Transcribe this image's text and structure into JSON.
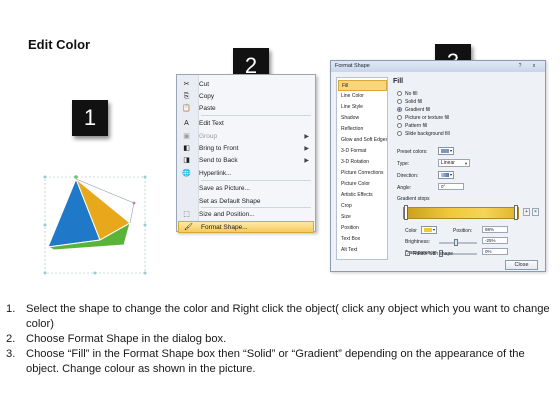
{
  "slide_title": "Edit Color",
  "badges": [
    "1",
    "2",
    "3"
  ],
  "context_menu": {
    "items": [
      {
        "label": "Cut",
        "icon": "scissors-icon",
        "glyph": "✂",
        "submenu": false,
        "disabled": false
      },
      {
        "label": "Copy",
        "icon": "copy-icon",
        "glyph": "⎘",
        "submenu": false,
        "disabled": false
      },
      {
        "label": "Paste",
        "icon": "paste-icon",
        "glyph": "📋",
        "submenu": false,
        "disabled": false
      },
      {
        "label": "Edit Text",
        "icon": "edit-text-icon",
        "glyph": "A",
        "submenu": false,
        "disabled": false
      },
      {
        "label": "Group",
        "icon": "group-icon",
        "glyph": "▣",
        "submenu": true,
        "disabled": true
      },
      {
        "label": "Bring to Front",
        "icon": "bring-to-front-icon",
        "glyph": "◧",
        "submenu": true,
        "disabled": false
      },
      {
        "label": "Send to Back",
        "icon": "send-to-back-icon",
        "glyph": "◨",
        "submenu": true,
        "disabled": false
      },
      {
        "label": "Hyperlink...",
        "icon": "hyperlink-icon",
        "glyph": "🌐",
        "submenu": false,
        "disabled": false
      },
      {
        "label": "Save as Picture...",
        "icon": "",
        "glyph": "",
        "submenu": false,
        "disabled": false
      },
      {
        "label": "Set as Default Shape",
        "icon": "",
        "glyph": "",
        "submenu": false,
        "disabled": false
      },
      {
        "label": "Size and Position...",
        "icon": "size-position-icon",
        "glyph": "⬚",
        "submenu": false,
        "disabled": false
      },
      {
        "label": "Format Shape...",
        "icon": "format-shape-icon",
        "glyph": "🖌",
        "submenu": false,
        "disabled": false,
        "highlighted": true
      }
    ]
  },
  "format_dialog": {
    "title": "Format Shape",
    "title_buttons": [
      "?",
      "x"
    ],
    "nav_items": [
      "Fill",
      "Line Color",
      "Line Style",
      "Shadow",
      "Reflection",
      "Glow and Soft Edges",
      "3-D Format",
      "3-D Rotation",
      "Picture Corrections",
      "Picture Color",
      "Artistic Effects",
      "Crop",
      "Size",
      "Position",
      "Text Box",
      "Alt Text"
    ],
    "selected_nav": "Fill",
    "panel_heading": "Fill",
    "fill_options": [
      "No fill",
      "Solid fill",
      "Gradient fill",
      "Picture or texture fill",
      "Pattern fill",
      "Slide background fill"
    ],
    "selected_fill": "Gradient fill",
    "preset_colors_label": "Preset colors:",
    "type_label": "Type:",
    "type_value": "Linear",
    "direction_label": "Direction:",
    "angle_label": "Angle:",
    "angle_value": "0°",
    "gradient_stops_label": "Gradient stops",
    "color_label": "Color",
    "position_label": "Position:",
    "position_value": "98%",
    "brightness_label": "Brightness:",
    "brightness_value": "-25%",
    "transparency_label": "Transparency:",
    "transparency_value": "0%",
    "rotate_label": "Rotate with shape",
    "rotate_checked": true,
    "close_label": "Close",
    "gradient_color": "#f1c83a"
  },
  "steps": [
    {
      "num": "1.",
      "text": "Select the shape to change the color and Right click the object( click any object which you want to change color)"
    },
    {
      "num": "2.",
      "text": "Choose Format Shape in the dialog box."
    },
    {
      "num": "3.",
      "text": "Choose “Fill” in the Format Shape box then “Solid” or “Gradient” depending on the appearance of the object. Change colour as shown in the picture."
    }
  ],
  "colors": {
    "triangle_left": "#1f78c8",
    "triangle_right": "#e8a81c",
    "triangle_bottom": "#5bb33a",
    "menu_highlight": "#f7c95c"
  }
}
